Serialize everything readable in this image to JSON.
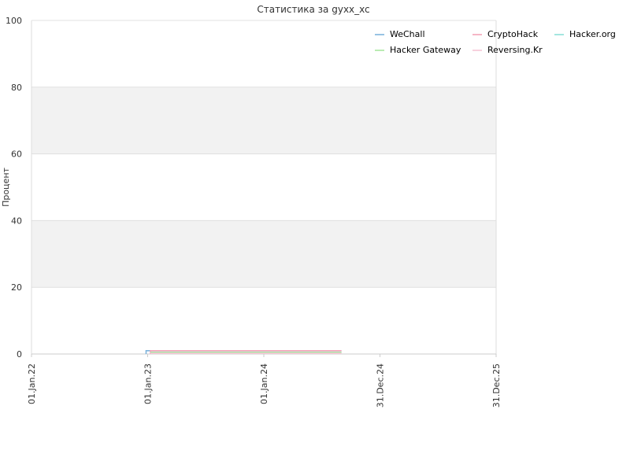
{
  "chart_data": {
    "type": "line",
    "title": "Статистика за gyxx_xc",
    "ylabel": "Процент",
    "ylim": [
      0,
      100
    ],
    "y_ticks": [
      "0",
      "20",
      "40",
      "60",
      "80",
      "100"
    ],
    "x_range": [
      "2022-01-01",
      "2025-12-31"
    ],
    "x_ticks": [
      {
        "date": "2022-01-01",
        "label": "01.Jan.22"
      },
      {
        "date": "2023-01-01",
        "label": "01.Jan.23"
      },
      {
        "date": "2024-01-01",
        "label": "01.Jan.24"
      },
      {
        "date": "2024-12-31",
        "label": "31.Dec.24"
      },
      {
        "date": "2025-12-31",
        "label": "31.Dec.25"
      }
    ],
    "grid": true,
    "banded_background": true,
    "legend_position": "top-right",
    "series": [
      {
        "name": "WeChall",
        "color": "#7fb4dc",
        "points": [
          [
            "2022-12-27",
            0
          ],
          [
            "2022-12-27",
            1
          ],
          [
            "2024-09-01",
            1
          ]
        ]
      },
      {
        "name": "CryptoHack",
        "color": "#f4a4b8",
        "points": [
          [
            "2023-01-10",
            0
          ],
          [
            "2023-01-10",
            1
          ],
          [
            "2024-09-01",
            1
          ]
        ]
      },
      {
        "name": "Hacker.org",
        "color": "#8ee0d8",
        "points": [
          [
            "2023-01-10",
            0.5
          ],
          [
            "2024-09-01",
            0.5
          ]
        ]
      },
      {
        "name": "Hacker Gateway",
        "color": "#a8e8a0",
        "points": [
          [
            "2023-01-10",
            0.5
          ],
          [
            "2024-09-01",
            0.5
          ]
        ]
      },
      {
        "name": "Reversing.Kr",
        "color": "#f6c6d6",
        "points": [
          [
            "2023-01-10",
            0.2
          ],
          [
            "2024-09-01",
            0.2
          ]
        ]
      }
    ]
  }
}
